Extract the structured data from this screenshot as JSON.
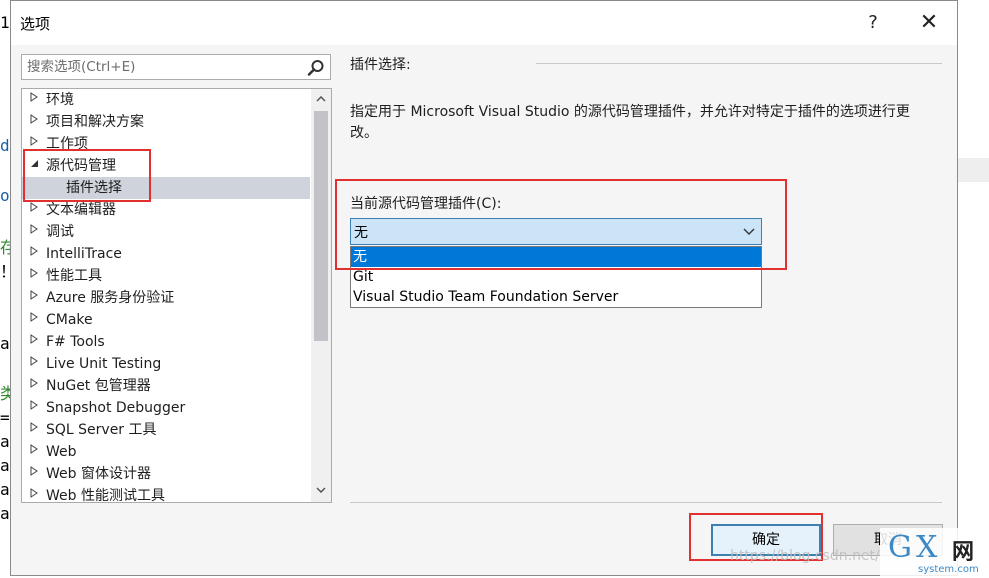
{
  "dialog": {
    "title": "选项",
    "help_label": "?",
    "close_label": "✕"
  },
  "search": {
    "placeholder": "搜索选项(Ctrl+E)"
  },
  "tree": {
    "items": [
      {
        "label": "环境",
        "expanded": false
      },
      {
        "label": "项目和解决方案",
        "expanded": false
      },
      {
        "label": "工作项",
        "expanded": false
      },
      {
        "label": "源代码管理",
        "expanded": true
      },
      {
        "label": "插件选择",
        "child": true,
        "selected": true
      },
      {
        "label": "文本编辑器",
        "expanded": false
      },
      {
        "label": "调试",
        "expanded": false
      },
      {
        "label": "IntelliTrace",
        "expanded": false
      },
      {
        "label": "性能工具",
        "expanded": false
      },
      {
        "label": "Azure 服务身份验证",
        "expanded": false
      },
      {
        "label": "CMake",
        "expanded": false
      },
      {
        "label": "F# Tools",
        "expanded": false
      },
      {
        "label": "Live Unit Testing",
        "expanded": false
      },
      {
        "label": "NuGet 包管理器",
        "expanded": false
      },
      {
        "label": "Snapshot Debugger",
        "expanded": false
      },
      {
        "label": "SQL Server 工具",
        "expanded": false
      },
      {
        "label": "Web",
        "expanded": false
      },
      {
        "label": "Web 窗体设计器",
        "expanded": false
      },
      {
        "label": "Web 性能测试工具",
        "expanded": false
      }
    ]
  },
  "panel": {
    "section_title": "插件选择:",
    "description": "指定用于 Microsoft Visual Studio 的源代码管理插件，并允许对特定于插件的选项进行更改。",
    "combo_label": "当前源代码管理插件(C):",
    "combo_value": "无",
    "options": [
      "无",
      "Git",
      "Visual Studio Team Foundation Server"
    ],
    "selected_index": 0
  },
  "buttons": {
    "ok": "确定",
    "cancel": "取消"
  },
  "background_code": {
    "lines": [
      "1",
      "d",
      "o",
      "存",
      "！",
      "a",
      "类",
      "=",
      "a",
      "a",
      "a",
      "a"
    ]
  },
  "watermark": {
    "url": "https://blog.csdn.net/",
    "logo_g": "G",
    "logo_x": "X",
    "logo_cn": "网",
    "logo_site": "system.com"
  },
  "colors": {
    "accent": "#0078d7",
    "annotation": "#e0302f",
    "selected_tree_bg": "#cfd3dc"
  }
}
